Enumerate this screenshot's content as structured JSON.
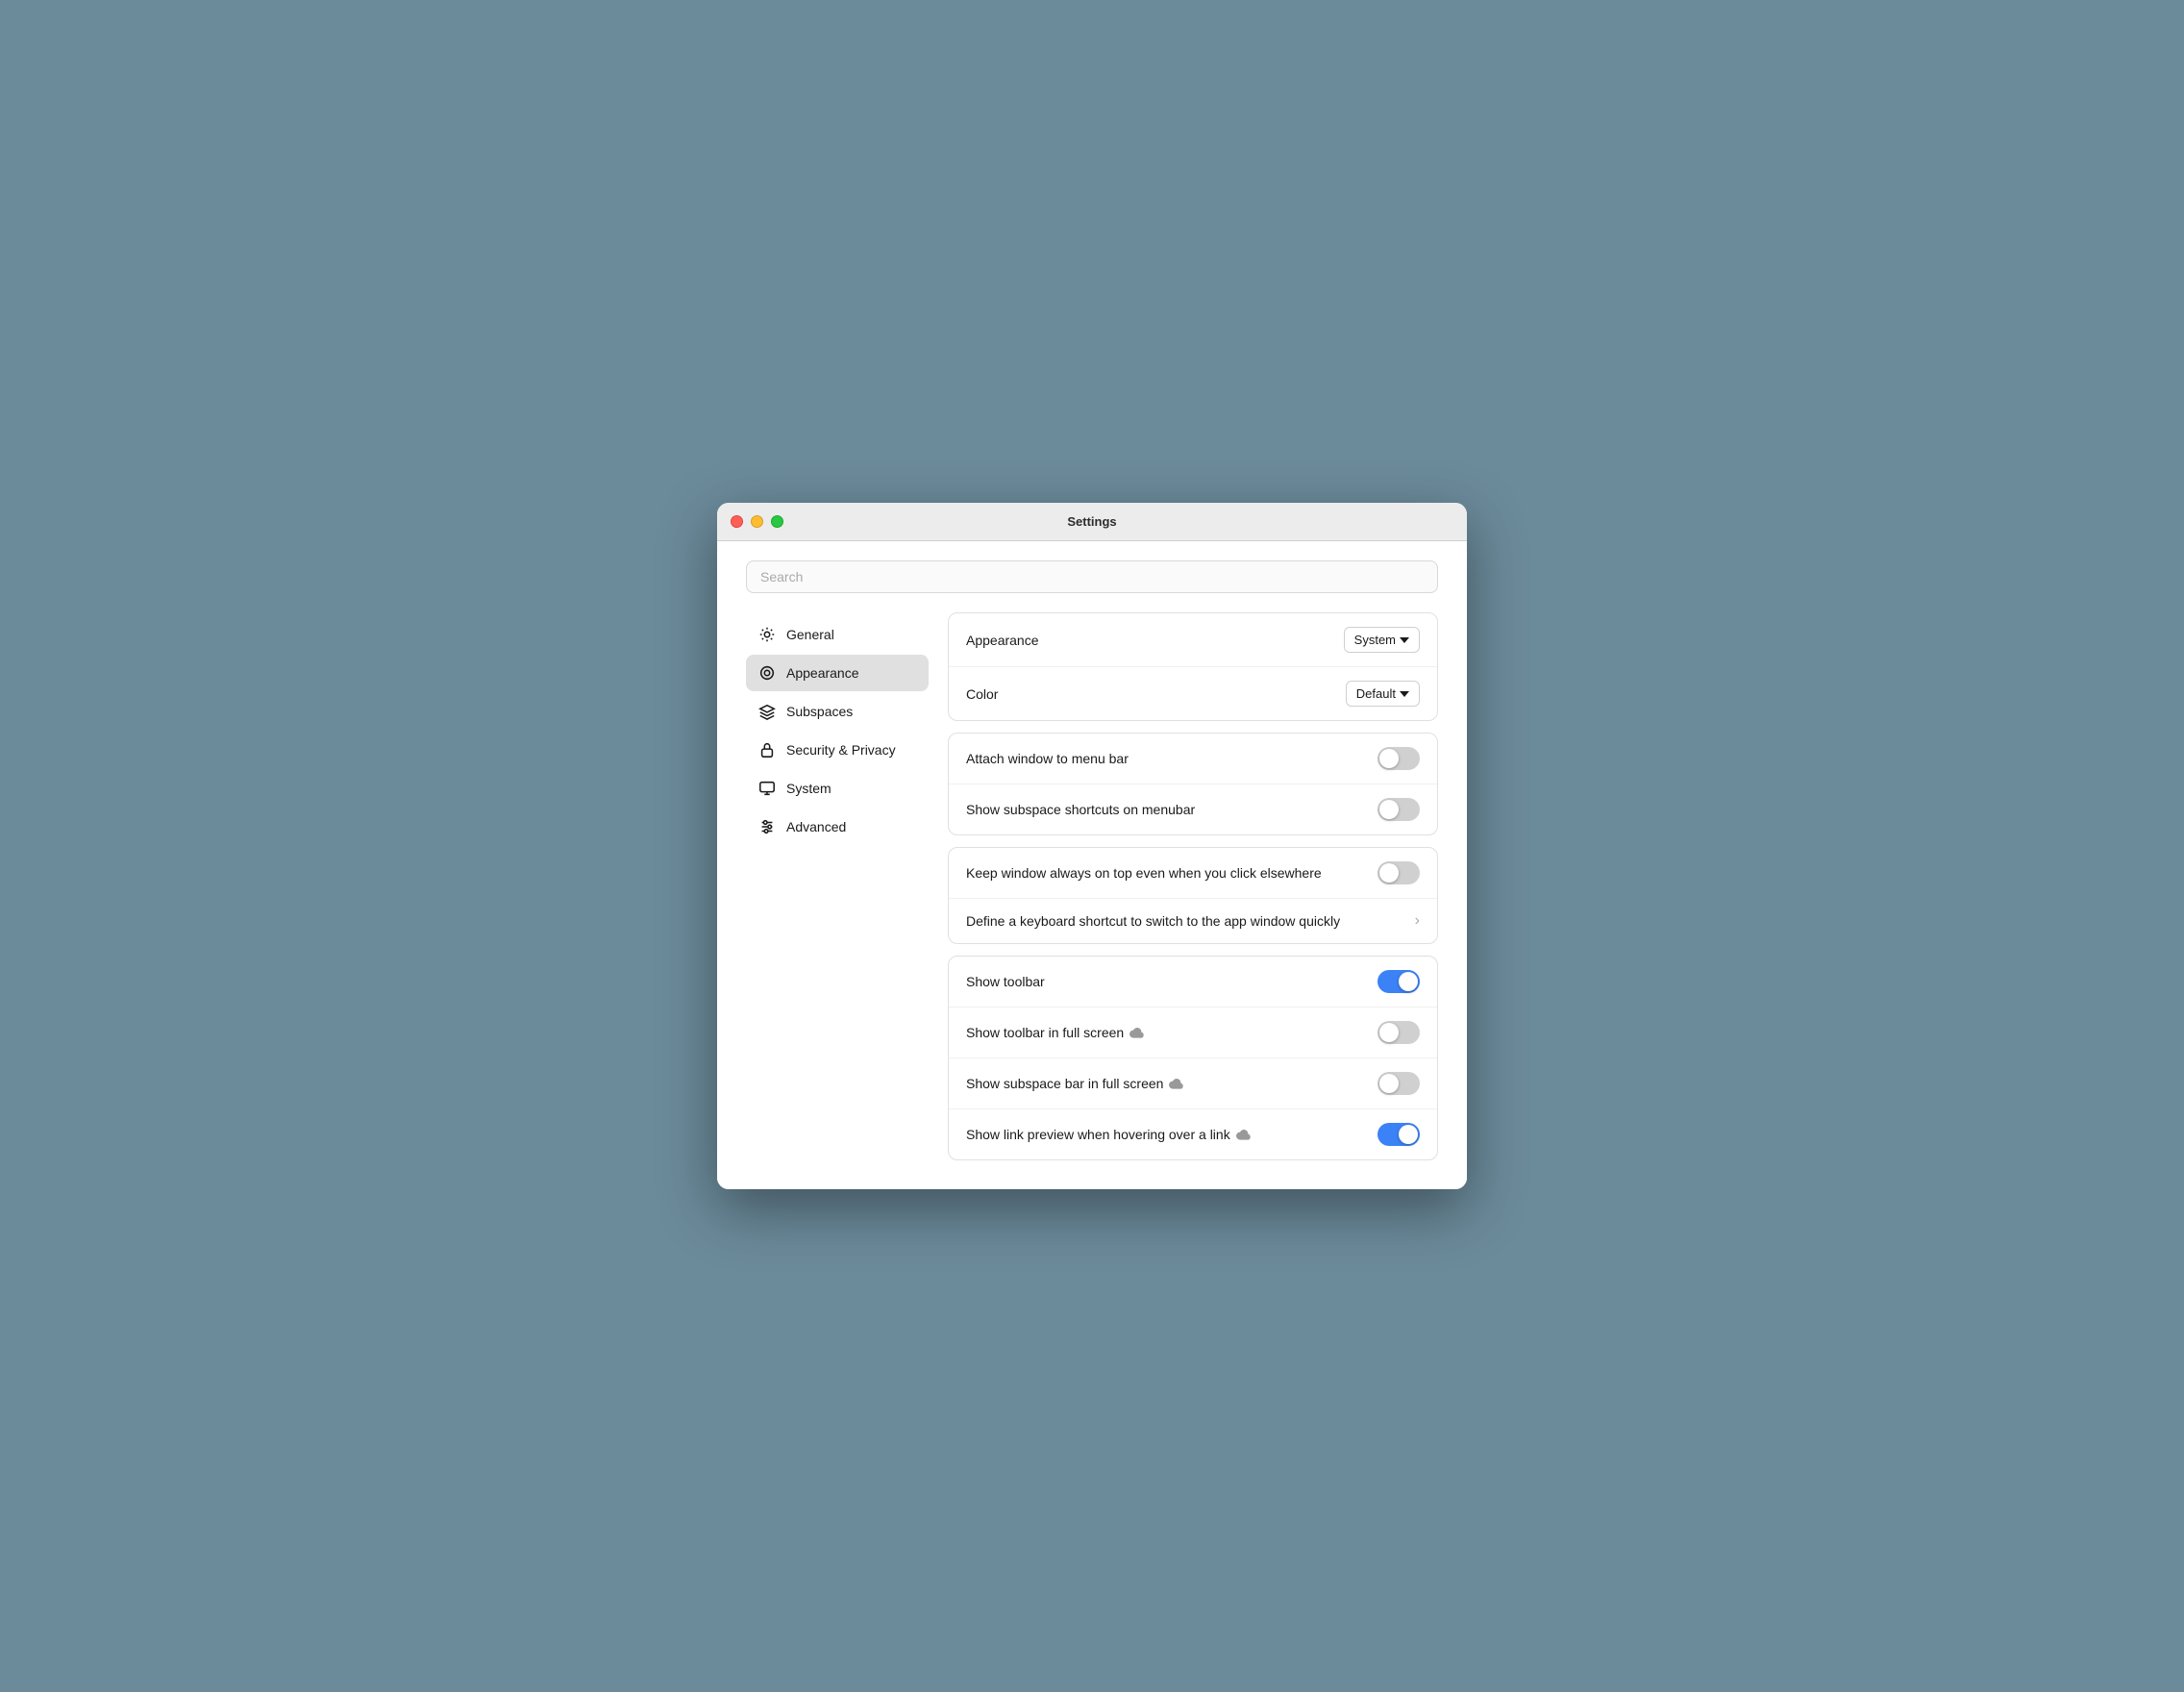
{
  "window": {
    "title": "Settings"
  },
  "search": {
    "placeholder": "Search"
  },
  "sidebar": {
    "items": [
      {
        "id": "general",
        "label": "General",
        "active": false
      },
      {
        "id": "appearance",
        "label": "Appearance",
        "active": true
      },
      {
        "id": "subspaces",
        "label": "Subspaces",
        "active": false
      },
      {
        "id": "security-privacy",
        "label": "Security & Privacy",
        "active": false
      },
      {
        "id": "system",
        "label": "System",
        "active": false
      },
      {
        "id": "advanced",
        "label": "Advanced",
        "active": false
      }
    ]
  },
  "main": {
    "cards": [
      {
        "id": "theme-card",
        "rows": [
          {
            "id": "appearance-row",
            "label": "Appearance",
            "control": "dropdown",
            "value": "System"
          },
          {
            "id": "color-row",
            "label": "Color",
            "control": "dropdown",
            "value": "Default"
          }
        ]
      },
      {
        "id": "menubar-card",
        "rows": [
          {
            "id": "attach-window-row",
            "label": "Attach window to menu bar",
            "control": "toggle",
            "checked": false
          },
          {
            "id": "show-subspace-shortcuts-row",
            "label": "Show subspace shortcuts on menubar",
            "control": "toggle",
            "checked": false
          }
        ]
      },
      {
        "id": "window-card",
        "rows": [
          {
            "id": "keep-window-top-row",
            "label": "Keep window always on top even when you click elsewhere",
            "control": "toggle",
            "checked": false
          },
          {
            "id": "keyboard-shortcut-row",
            "label": "Define a keyboard shortcut to switch to the app window quickly",
            "control": "chevron",
            "checked": false
          }
        ]
      },
      {
        "id": "toolbar-card",
        "rows": [
          {
            "id": "show-toolbar-row",
            "label": "Show toolbar",
            "control": "toggle",
            "checked": true,
            "cloud": false
          },
          {
            "id": "show-toolbar-fullscreen-row",
            "label": "Show toolbar in full screen",
            "control": "toggle",
            "checked": false,
            "cloud": true
          },
          {
            "id": "show-subspace-bar-fullscreen-row",
            "label": "Show subspace bar in full screen",
            "control": "toggle",
            "checked": false,
            "cloud": true
          },
          {
            "id": "show-link-preview-row",
            "label": "Show link preview when hovering over a link",
            "control": "toggle",
            "checked": true,
            "cloud": true
          }
        ]
      }
    ]
  }
}
